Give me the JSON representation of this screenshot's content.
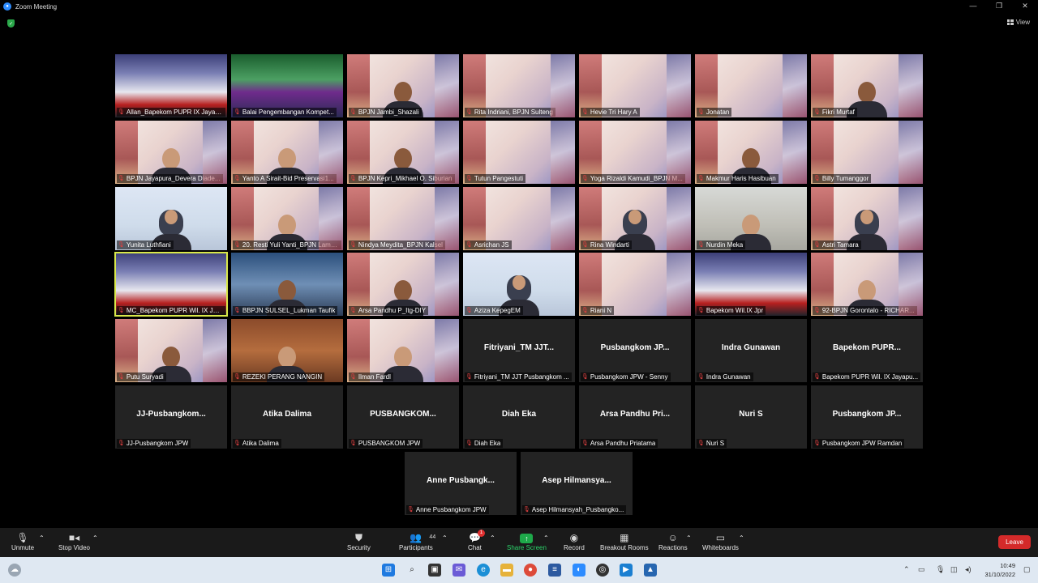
{
  "window": {
    "title": "Zoom Meeting",
    "controls": [
      "—",
      "❐",
      "✕"
    ]
  },
  "view_label": "View",
  "tiles": [
    {
      "name": "Allan_Bapekom PUPR IX Jayapu...",
      "bg": "bapekom"
    },
    {
      "name": "Balai Pengembangan Kompet...",
      "bg": "green"
    },
    {
      "name": "BPJN Jambi_Shazali",
      "bg": "banner",
      "person": "dark"
    },
    {
      "name": "Rita Indriani, BPJN Sulteng",
      "bg": "banner"
    },
    {
      "name": "Hevie Tri Hary A",
      "bg": "banner"
    },
    {
      "name": "Jonatan",
      "bg": "banner"
    },
    {
      "name": "Fikri Murtaf",
      "bg": "banner",
      "person": "dark"
    },
    {
      "name": "BPJN Jayapura_Devera Diade...",
      "bg": "banner",
      "person": "light"
    },
    {
      "name": "Yanto A Sirait-Bid Preservasi1...",
      "bg": "banner",
      "person": "light"
    },
    {
      "name": "BPJN Kepri_Mikhael O. Siburian",
      "bg": "banner",
      "person": "dark"
    },
    {
      "name": "Tutun Pangestuti",
      "bg": "banner"
    },
    {
      "name": "Yoga Rizaldi Kamudi_BPJN M...",
      "bg": "banner"
    },
    {
      "name": "Makmur Haris Hasibuan",
      "bg": "banner",
      "person": "dark"
    },
    {
      "name": "Billy Tumanggor",
      "bg": "banner"
    },
    {
      "name": "Yunita Luthfiani",
      "bg": "blue",
      "person": "hijab"
    },
    {
      "name": "20. Resti Yuli Yanti_BPJN Lamp...",
      "bg": "banner",
      "person": "light"
    },
    {
      "name": "Nindya Meydita_BPJN Kalsel",
      "bg": "banner"
    },
    {
      "name": "Asrichan JS",
      "bg": "banner"
    },
    {
      "name": "Rina Windarti",
      "bg": "banner",
      "person": "hijab"
    },
    {
      "name": "Nurdin Meka",
      "bg": "room",
      "person": "light"
    },
    {
      "name": "Astri Tamara",
      "bg": "banner",
      "person": "hijab"
    },
    {
      "name": "MC_Bapekom PUPR Wil. IX Jayap...",
      "bg": "bapekom",
      "active": true
    },
    {
      "name": "BBPJN SULSEL_Lukman Taufik",
      "bg": "office",
      "person": "dark"
    },
    {
      "name": "Arsa Pandhu P_Itg-DIY",
      "bg": "banner",
      "person": "dark"
    },
    {
      "name": "Aziza KepegEM",
      "bg": "blue",
      "person": "hijab"
    },
    {
      "name": "Riani N",
      "bg": "banner"
    },
    {
      "name": "Bapekom Wil.IX Jpr",
      "bg": "bapekom"
    },
    {
      "name": "92-BPJN Gorontalo - RICHAR...",
      "bg": "banner",
      "person": "light"
    },
    {
      "name": "Putu Suryadi",
      "bg": "banner",
      "person": "dark"
    },
    {
      "name": "REZEKI PERANG NANGIN",
      "bg": "wood",
      "person": "light"
    },
    {
      "name": "Ilman Fardl",
      "bg": "banner",
      "person": "light"
    },
    {
      "name": "Fitriyani_TM JJT Pusbangkom ...",
      "big": "Fitriyani_TM JJT..."
    },
    {
      "name": "Pusbangkom JPW - Senny",
      "big": "Pusbangkom JP..."
    },
    {
      "name": "Indra Gunawan",
      "big": "Indra Gunawan"
    },
    {
      "name": "Bapekom PUPR Wil. IX Jayapu...",
      "big": "Bapekom PUPR..."
    },
    {
      "name": "JJ-Pusbangkom JPW",
      "big": "JJ-Pusbangkom..."
    },
    {
      "name": "Atika Dalima",
      "big": "Atika Dalima"
    },
    {
      "name": "PUSBANGKOM JPW",
      "big": "PUSBANGKOM..."
    },
    {
      "name": "Diah Eka",
      "big": "Diah Eka"
    },
    {
      "name": "Arsa Pandhu Priatama",
      "big": "Arsa Pandhu Pri..."
    },
    {
      "name": "Nuri S",
      "big": "Nuri S"
    },
    {
      "name": "Pusbangkom JPW Ramdan",
      "big": "Pusbangkom JP..."
    },
    {
      "name": "Anne Pusbangkom JPW",
      "big": "Anne Pusbangk..."
    },
    {
      "name": "Asep Hilmansyah_Pusbangko...",
      "big": "Asep Hilmansya..."
    }
  ],
  "toolbar": {
    "unmute": "Unmute",
    "stop_video": "Stop Video",
    "security": "Security",
    "participants": "Participants",
    "participants_count": "44",
    "chat": "Chat",
    "chat_badge": "1",
    "share_screen": "Share Screen",
    "record": "Record",
    "breakout": "Breakout Rooms",
    "reactions": "Reactions",
    "whiteboards": "Whiteboards",
    "leave": "Leave"
  },
  "taskbar": {
    "time": "10:49",
    "date": "31/10/2022"
  }
}
